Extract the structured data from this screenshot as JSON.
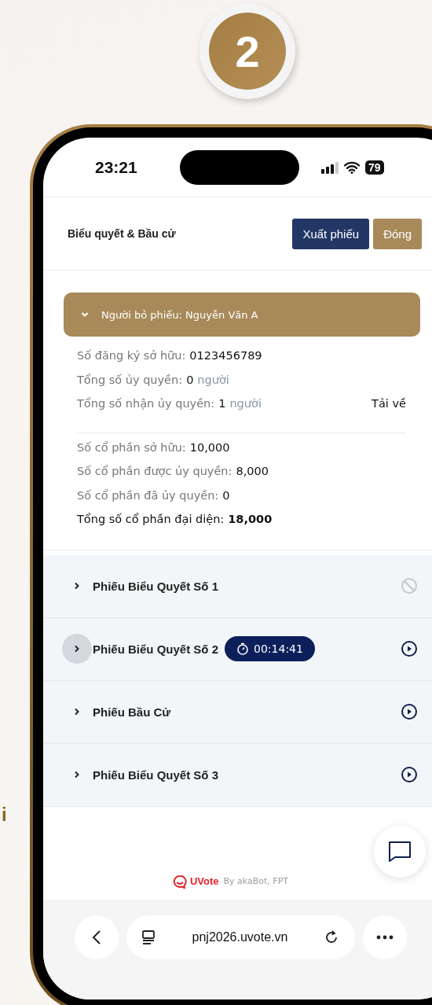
{
  "step_badge": "2",
  "side_fragment": "i",
  "status_bar": {
    "time": "23:21",
    "battery": "79"
  },
  "header": {
    "title": "Biểu quyết & Bầu cử",
    "buttons": [
      {
        "label": "Xuất phiếu",
        "kind": "primary"
      },
      {
        "label": "Đóng",
        "kind": "secondary"
      }
    ]
  },
  "voter": {
    "title": "Người bỏ phiếu: Nguyễn Văn A",
    "expanded": true,
    "info": [
      {
        "label": "Số đăng ký sở hữu:",
        "value": "0123456789"
      },
      {
        "label": "Tổng số ủy quyền:",
        "value": "0",
        "unit": "người"
      },
      {
        "label": "Tổng số nhận ủy quyền:",
        "value": "1",
        "unit": "người",
        "action": "Tải về"
      }
    ],
    "shares": [
      {
        "label": "Số cổ phần sở hữu:",
        "value": "10,000",
        "emphasis": false
      },
      {
        "label": "Số cổ phần được ủy quyền:",
        "value": "8,000",
        "emphasis": false
      },
      {
        "label": "Số cổ phần đã ủy quyền:",
        "value": "0",
        "emphasis": false
      },
      {
        "label": "Tổng số cổ phần đại diện:",
        "value": "18,000",
        "emphasis": true
      }
    ]
  },
  "ballots": [
    {
      "title": "Phiếu Biểu Quyết Số 1",
      "expanded": false,
      "highlighted": false,
      "kind": "disabled"
    },
    {
      "title": "Phiếu Biểu Quyết Số 2",
      "expanded": false,
      "highlighted": true,
      "timer": "00:14:41",
      "kind": "playable"
    },
    {
      "title": "Phiếu Bầu Cử",
      "expanded": false,
      "highlighted": false,
      "kind": "playable"
    },
    {
      "title": "Phiếu Biểu Quyết Số 3",
      "expanded": false,
      "highlighted": false,
      "kind": "playable"
    }
  ],
  "footer": {
    "brand": "UVote",
    "credit": "By akaBot, FPT"
  },
  "browser": {
    "url": "pnj2026.uvote.vn"
  }
}
